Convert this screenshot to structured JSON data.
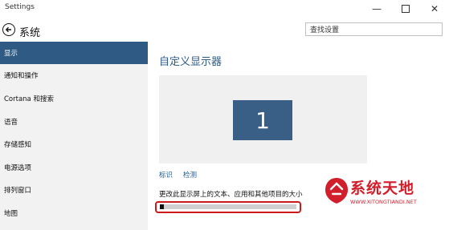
{
  "window": {
    "title": "Settings",
    "controls": {
      "minimize": "—",
      "close": "✕"
    }
  },
  "header": {
    "page_title": "系统",
    "search": {
      "value": "查找设置",
      "placeholder": "查找设置"
    }
  },
  "sidebar": {
    "items": [
      {
        "label": "显示",
        "active": true
      },
      {
        "label": "通知和操作"
      },
      {
        "label": "Cortana 和搜索"
      },
      {
        "label": "语音"
      },
      {
        "label": "存储感知"
      },
      {
        "label": "电源选项"
      },
      {
        "label": "排列窗口"
      },
      {
        "label": "地图"
      }
    ]
  },
  "main": {
    "title": "自定义显示器",
    "monitor_number": "1",
    "links": {
      "identify": "标识",
      "detect": "检测"
    },
    "scale_label": "更改此显示屏上的文本、应用和其他项目的大小",
    "scale_slider_value": 0
  },
  "watermark": {
    "text": "系统天地",
    "url": "WWW.XITONGTIANDI.NET"
  },
  "colors": {
    "accent": "#2e5a84",
    "link": "#1a5e9e",
    "highlight_outline": "#cc1a1a",
    "watermark": "#d21e2b"
  }
}
